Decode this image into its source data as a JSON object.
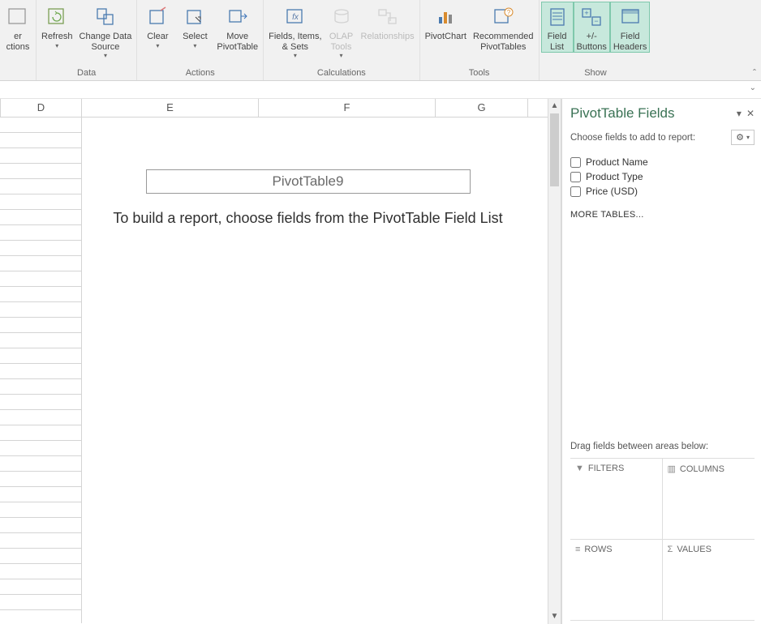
{
  "ribbon": {
    "group0": {
      "btn1": "er",
      "btn2": "ctions"
    },
    "data": {
      "label": "Data",
      "refresh": "Refresh",
      "changeData": "Change Data\nSource"
    },
    "actions": {
      "label": "Actions",
      "clear": "Clear",
      "select": "Select",
      "move": "Move\nPivotTable"
    },
    "calculations": {
      "label": "Calculations",
      "fields": "Fields, Items,\n& Sets",
      "olap": "OLAP\nTools",
      "relationships": "Relationships"
    },
    "tools": {
      "label": "Tools",
      "pivotChart": "PivotChart",
      "recommended": "Recommended\nPivotTables"
    },
    "show": {
      "label": "Show",
      "fieldList": "Field\nList",
      "buttons": "+/-\nButtons",
      "headers": "Field\nHeaders"
    }
  },
  "columns": {
    "d": "D",
    "e": "E",
    "f": "F",
    "g": "G"
  },
  "pivot": {
    "name": "PivotTable9",
    "msg": "To build a report, choose fields from the PivotTable Field List"
  },
  "pane": {
    "title": "PivotTable Fields",
    "sub": "Choose fields to add to report:",
    "fields": {
      "f0": "Product Name",
      "f1": "Product Type",
      "f2": "Price (USD)"
    },
    "more": "MORE TABLES...",
    "drag": "Drag fields between areas below:",
    "areas": {
      "filters": "FILTERS",
      "columns": "COLUMNS",
      "rows": "ROWS",
      "values": "VALUES"
    }
  }
}
